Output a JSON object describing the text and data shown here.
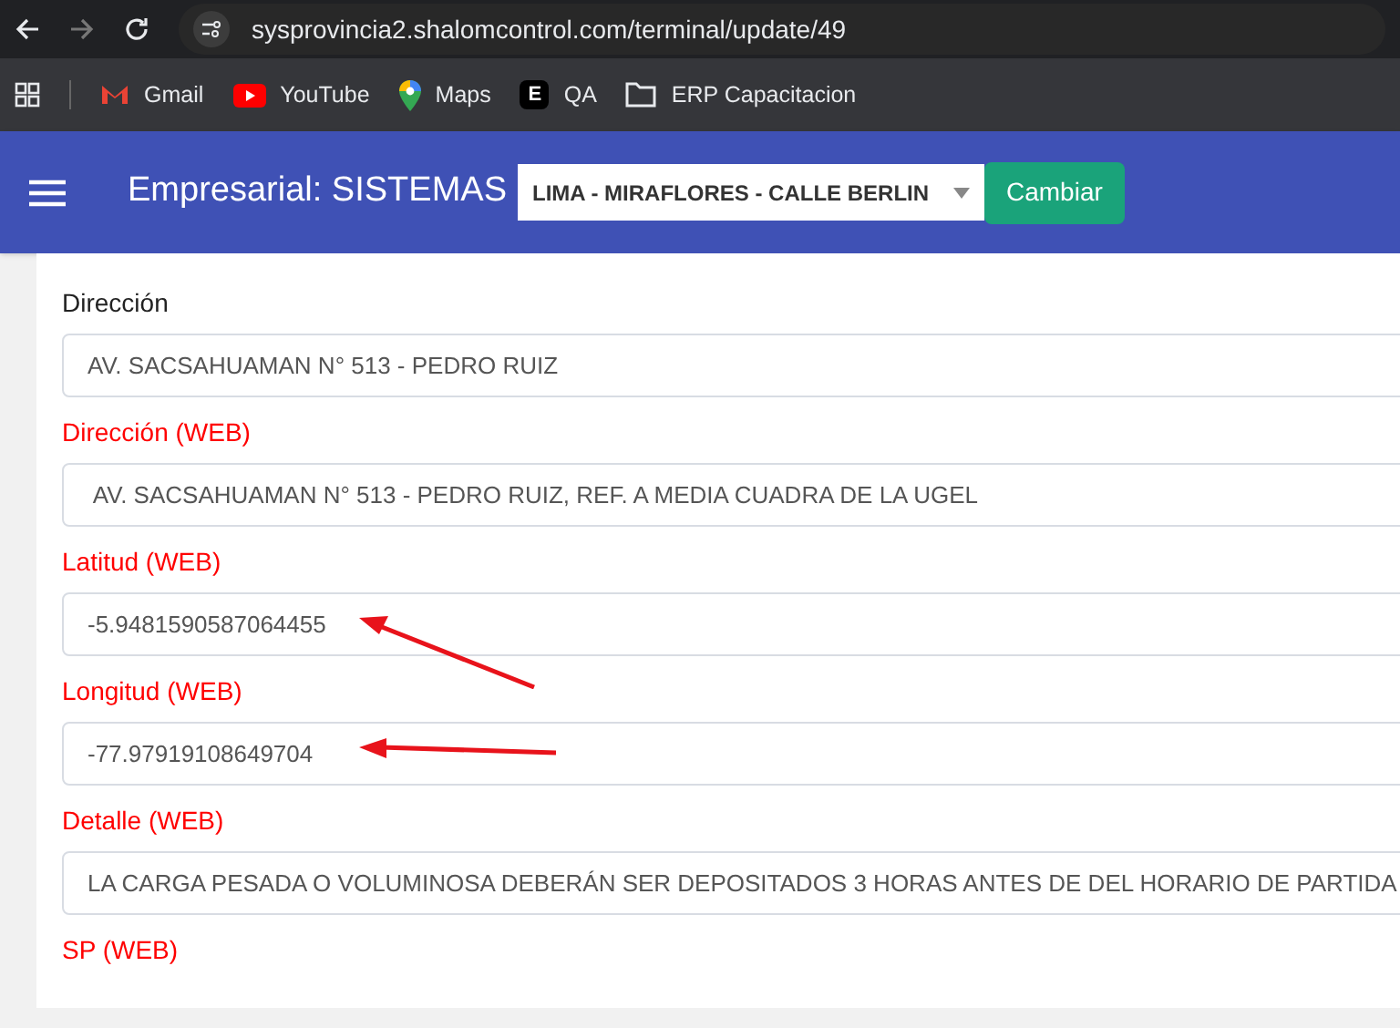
{
  "browser": {
    "url": "sysprovincia2.shalomcontrol.com/terminal/update/49",
    "bookmarks": [
      {
        "kind": "gmail",
        "label": "Gmail"
      },
      {
        "kind": "youtube",
        "label": "YouTube"
      },
      {
        "kind": "maps",
        "label": "Maps"
      },
      {
        "kind": "letter",
        "icon_text": "E",
        "label": "QA"
      },
      {
        "kind": "folder",
        "label": "ERP Capacitacion"
      }
    ]
  },
  "header": {
    "title": "Empresarial: SISTEMAS",
    "branch_select": {
      "value": "LIMA - MIRAFLORES - CALLE BERLIN"
    },
    "change_button": "Cambiar"
  },
  "form": {
    "fields": [
      {
        "label": "Dirección",
        "web": false,
        "value": "AV. SACSAHUAMAN N° 513 - PEDRO RUIZ",
        "arrow": false
      },
      {
        "label": "Dirección (WEB)",
        "web": true,
        "value": " AV. SACSAHUAMAN N° 513 - PEDRO RUIZ, REF. A MEDIA CUADRA DE LA UGEL",
        "arrow": false
      },
      {
        "label": "Latitud (WEB)",
        "web": true,
        "value": "-5.9481590587064455",
        "arrow": true
      },
      {
        "label": "Longitud (WEB)",
        "web": true,
        "value": "-77.97919108649704",
        "arrow": true
      },
      {
        "label": "Detalle (WEB)",
        "web": true,
        "value": "LA CARGA PESADA O VOLUMINOSA DEBERÁN SER DEPOSITADOS 3 HORAS ANTES DE DEL HORARIO DE PARTIDA",
        "arrow": false
      }
    ],
    "next_label": {
      "label": "SP (WEB)",
      "web": true
    }
  }
}
